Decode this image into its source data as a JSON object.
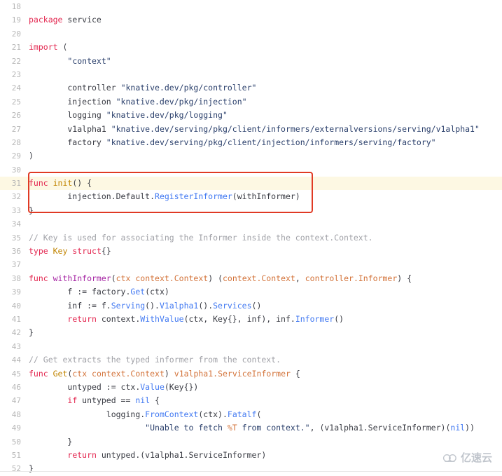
{
  "viewer": {
    "language": "go",
    "first_line": 18,
    "last_line": 52,
    "highlight_line": 31,
    "colors": {
      "background": "#ffffff",
      "line_highlight": "#fdf8e3",
      "annotation_box": "#e03a24",
      "keyword": "#e3264f",
      "function_name": "#c18401",
      "function_purple": "#a626a4",
      "type": "#d3733a",
      "string": "#2a3f6b",
      "call": "#4078f2",
      "comment": "#a0a1a7",
      "plain": "#383a42",
      "line_number": "#b6b6b6"
    }
  },
  "annotation": {
    "name": "init-function-box",
    "lines": [
      31,
      32,
      33
    ]
  },
  "watermark": {
    "text": "亿速云",
    "icon": "cloud-icon"
  },
  "lines": [
    {
      "n": "18",
      "tokens": []
    },
    {
      "n": "19",
      "tokens": [
        {
          "t": "package",
          "c": "kw"
        },
        {
          "t": " service",
          "c": "pl"
        }
      ]
    },
    {
      "n": "20",
      "tokens": []
    },
    {
      "n": "21",
      "tokens": [
        {
          "t": "import",
          "c": "kw"
        },
        {
          "t": " (",
          "c": "pl"
        }
      ]
    },
    {
      "n": "22",
      "tokens": [
        {
          "t": "        ",
          "c": "pl"
        },
        {
          "t": "\"context\"",
          "c": "str"
        }
      ]
    },
    {
      "n": "23",
      "tokens": []
    },
    {
      "n": "24",
      "tokens": [
        {
          "t": "        controller ",
          "c": "pl"
        },
        {
          "t": "\"knative.dev/pkg/controller\"",
          "c": "str"
        }
      ]
    },
    {
      "n": "25",
      "tokens": [
        {
          "t": "        injection ",
          "c": "pl"
        },
        {
          "t": "\"knative.dev/pkg/injection\"",
          "c": "str"
        }
      ]
    },
    {
      "n": "26",
      "tokens": [
        {
          "t": "        logging ",
          "c": "pl"
        },
        {
          "t": "\"knative.dev/pkg/logging\"",
          "c": "str"
        }
      ]
    },
    {
      "n": "27",
      "tokens": [
        {
          "t": "        v1alpha1 ",
          "c": "pl"
        },
        {
          "t": "\"knative.dev/serving/pkg/client/informers/externalversions/serving/v1alpha1\"",
          "c": "str"
        }
      ]
    },
    {
      "n": "28",
      "tokens": [
        {
          "t": "        factory ",
          "c": "pl"
        },
        {
          "t": "\"knative.dev/serving/pkg/client/injection/informers/serving/factory\"",
          "c": "str"
        }
      ]
    },
    {
      "n": "29",
      "tokens": [
        {
          "t": ")",
          "c": "pl"
        }
      ]
    },
    {
      "n": "30",
      "tokens": []
    },
    {
      "n": "31",
      "hl": true,
      "tokens": [
        {
          "t": "func ",
          "c": "kw"
        },
        {
          "t": "init",
          "c": "fnm"
        },
        {
          "t": "() {",
          "c": "pl"
        }
      ]
    },
    {
      "n": "32",
      "tokens": [
        {
          "t": "        injection.Default.",
          "c": "pl"
        },
        {
          "t": "RegisterInformer",
          "c": "call"
        },
        {
          "t": "(withInformer)",
          "c": "pl"
        }
      ]
    },
    {
      "n": "33",
      "tokens": [
        {
          "t": "}",
          "c": "pl"
        }
      ]
    },
    {
      "n": "34",
      "tokens": []
    },
    {
      "n": "35",
      "tokens": [
        {
          "t": "// Key is used for associating the Informer inside the context.Context.",
          "c": "com"
        }
      ]
    },
    {
      "n": "36",
      "tokens": [
        {
          "t": "type ",
          "c": "kw"
        },
        {
          "t": "Key",
          "c": "fnm"
        },
        {
          "t": " ",
          "c": "pl"
        },
        {
          "t": "struct",
          "c": "kw"
        },
        {
          "t": "{}",
          "c": "pl"
        }
      ]
    },
    {
      "n": "37",
      "tokens": []
    },
    {
      "n": "38",
      "tokens": [
        {
          "t": "func ",
          "c": "kw"
        },
        {
          "t": "withInformer",
          "c": "fnv"
        },
        {
          "t": "(",
          "c": "pl"
        },
        {
          "t": "ctx context.Context",
          "c": "typ"
        },
        {
          "t": ") (",
          "c": "pl"
        },
        {
          "t": "context.Context",
          "c": "typ"
        },
        {
          "t": ", ",
          "c": "pl"
        },
        {
          "t": "controller.Informer",
          "c": "typ"
        },
        {
          "t": ") {",
          "c": "pl"
        }
      ]
    },
    {
      "n": "39",
      "tokens": [
        {
          "t": "        f := factory.",
          "c": "pl"
        },
        {
          "t": "Get",
          "c": "call"
        },
        {
          "t": "(ctx)",
          "c": "pl"
        }
      ]
    },
    {
      "n": "40",
      "tokens": [
        {
          "t": "        inf := f.",
          "c": "pl"
        },
        {
          "t": "Serving",
          "c": "call"
        },
        {
          "t": "().",
          "c": "pl"
        },
        {
          "t": "V1alpha1",
          "c": "call"
        },
        {
          "t": "().",
          "c": "pl"
        },
        {
          "t": "Services",
          "c": "call"
        },
        {
          "t": "()",
          "c": "pl"
        }
      ]
    },
    {
      "n": "41",
      "tokens": [
        {
          "t": "        ",
          "c": "pl"
        },
        {
          "t": "return",
          "c": "kw"
        },
        {
          "t": " context.",
          "c": "pl"
        },
        {
          "t": "WithValue",
          "c": "call"
        },
        {
          "t": "(ctx, Key{}, inf), inf.",
          "c": "pl"
        },
        {
          "t": "Informer",
          "c": "call"
        },
        {
          "t": "()",
          "c": "pl"
        }
      ]
    },
    {
      "n": "42",
      "tokens": [
        {
          "t": "}",
          "c": "pl"
        }
      ]
    },
    {
      "n": "43",
      "tokens": []
    },
    {
      "n": "44",
      "tokens": [
        {
          "t": "// Get extracts the typed informer from the context.",
          "c": "com"
        }
      ]
    },
    {
      "n": "45",
      "tokens": [
        {
          "t": "func ",
          "c": "kw"
        },
        {
          "t": "Get",
          "c": "fnm"
        },
        {
          "t": "(",
          "c": "pl"
        },
        {
          "t": "ctx context.Context",
          "c": "typ"
        },
        {
          "t": ") ",
          "c": "pl"
        },
        {
          "t": "v1alpha1.ServiceInformer",
          "c": "typ"
        },
        {
          "t": " {",
          "c": "pl"
        }
      ]
    },
    {
      "n": "46",
      "tokens": [
        {
          "t": "        untyped := ctx.",
          "c": "pl"
        },
        {
          "t": "Value",
          "c": "call"
        },
        {
          "t": "(Key{})",
          "c": "pl"
        }
      ]
    },
    {
      "n": "47",
      "tokens": [
        {
          "t": "        ",
          "c": "pl"
        },
        {
          "t": "if",
          "c": "kw"
        },
        {
          "t": " untyped == ",
          "c": "pl"
        },
        {
          "t": "nil",
          "c": "call"
        },
        {
          "t": " {",
          "c": "pl"
        }
      ]
    },
    {
      "n": "48",
      "tokens": [
        {
          "t": "                logging.",
          "c": "pl"
        },
        {
          "t": "FromContext",
          "c": "call"
        },
        {
          "t": "(ctx).",
          "c": "pl"
        },
        {
          "t": "Fatalf",
          "c": "call"
        },
        {
          "t": "(",
          "c": "pl"
        }
      ]
    },
    {
      "n": "49",
      "tokens": [
        {
          "t": "                        ",
          "c": "pl"
        },
        {
          "t": "\"Unable to fetch ",
          "c": "str"
        },
        {
          "t": "%T",
          "c": "fmt"
        },
        {
          "t": " from context.\"",
          "c": "str"
        },
        {
          "t": ", (v1alpha1.ServiceInformer)(",
          "c": "pl"
        },
        {
          "t": "nil",
          "c": "call"
        },
        {
          "t": "))",
          "c": "pl"
        }
      ]
    },
    {
      "n": "50",
      "tokens": [
        {
          "t": "        }",
          "c": "pl"
        }
      ]
    },
    {
      "n": "51",
      "tokens": [
        {
          "t": "        ",
          "c": "pl"
        },
        {
          "t": "return",
          "c": "kw"
        },
        {
          "t": " untyped.(v1alpha1.ServiceInformer)",
          "c": "pl"
        }
      ]
    },
    {
      "n": "52",
      "tokens": [
        {
          "t": "}",
          "c": "pl"
        }
      ]
    }
  ]
}
